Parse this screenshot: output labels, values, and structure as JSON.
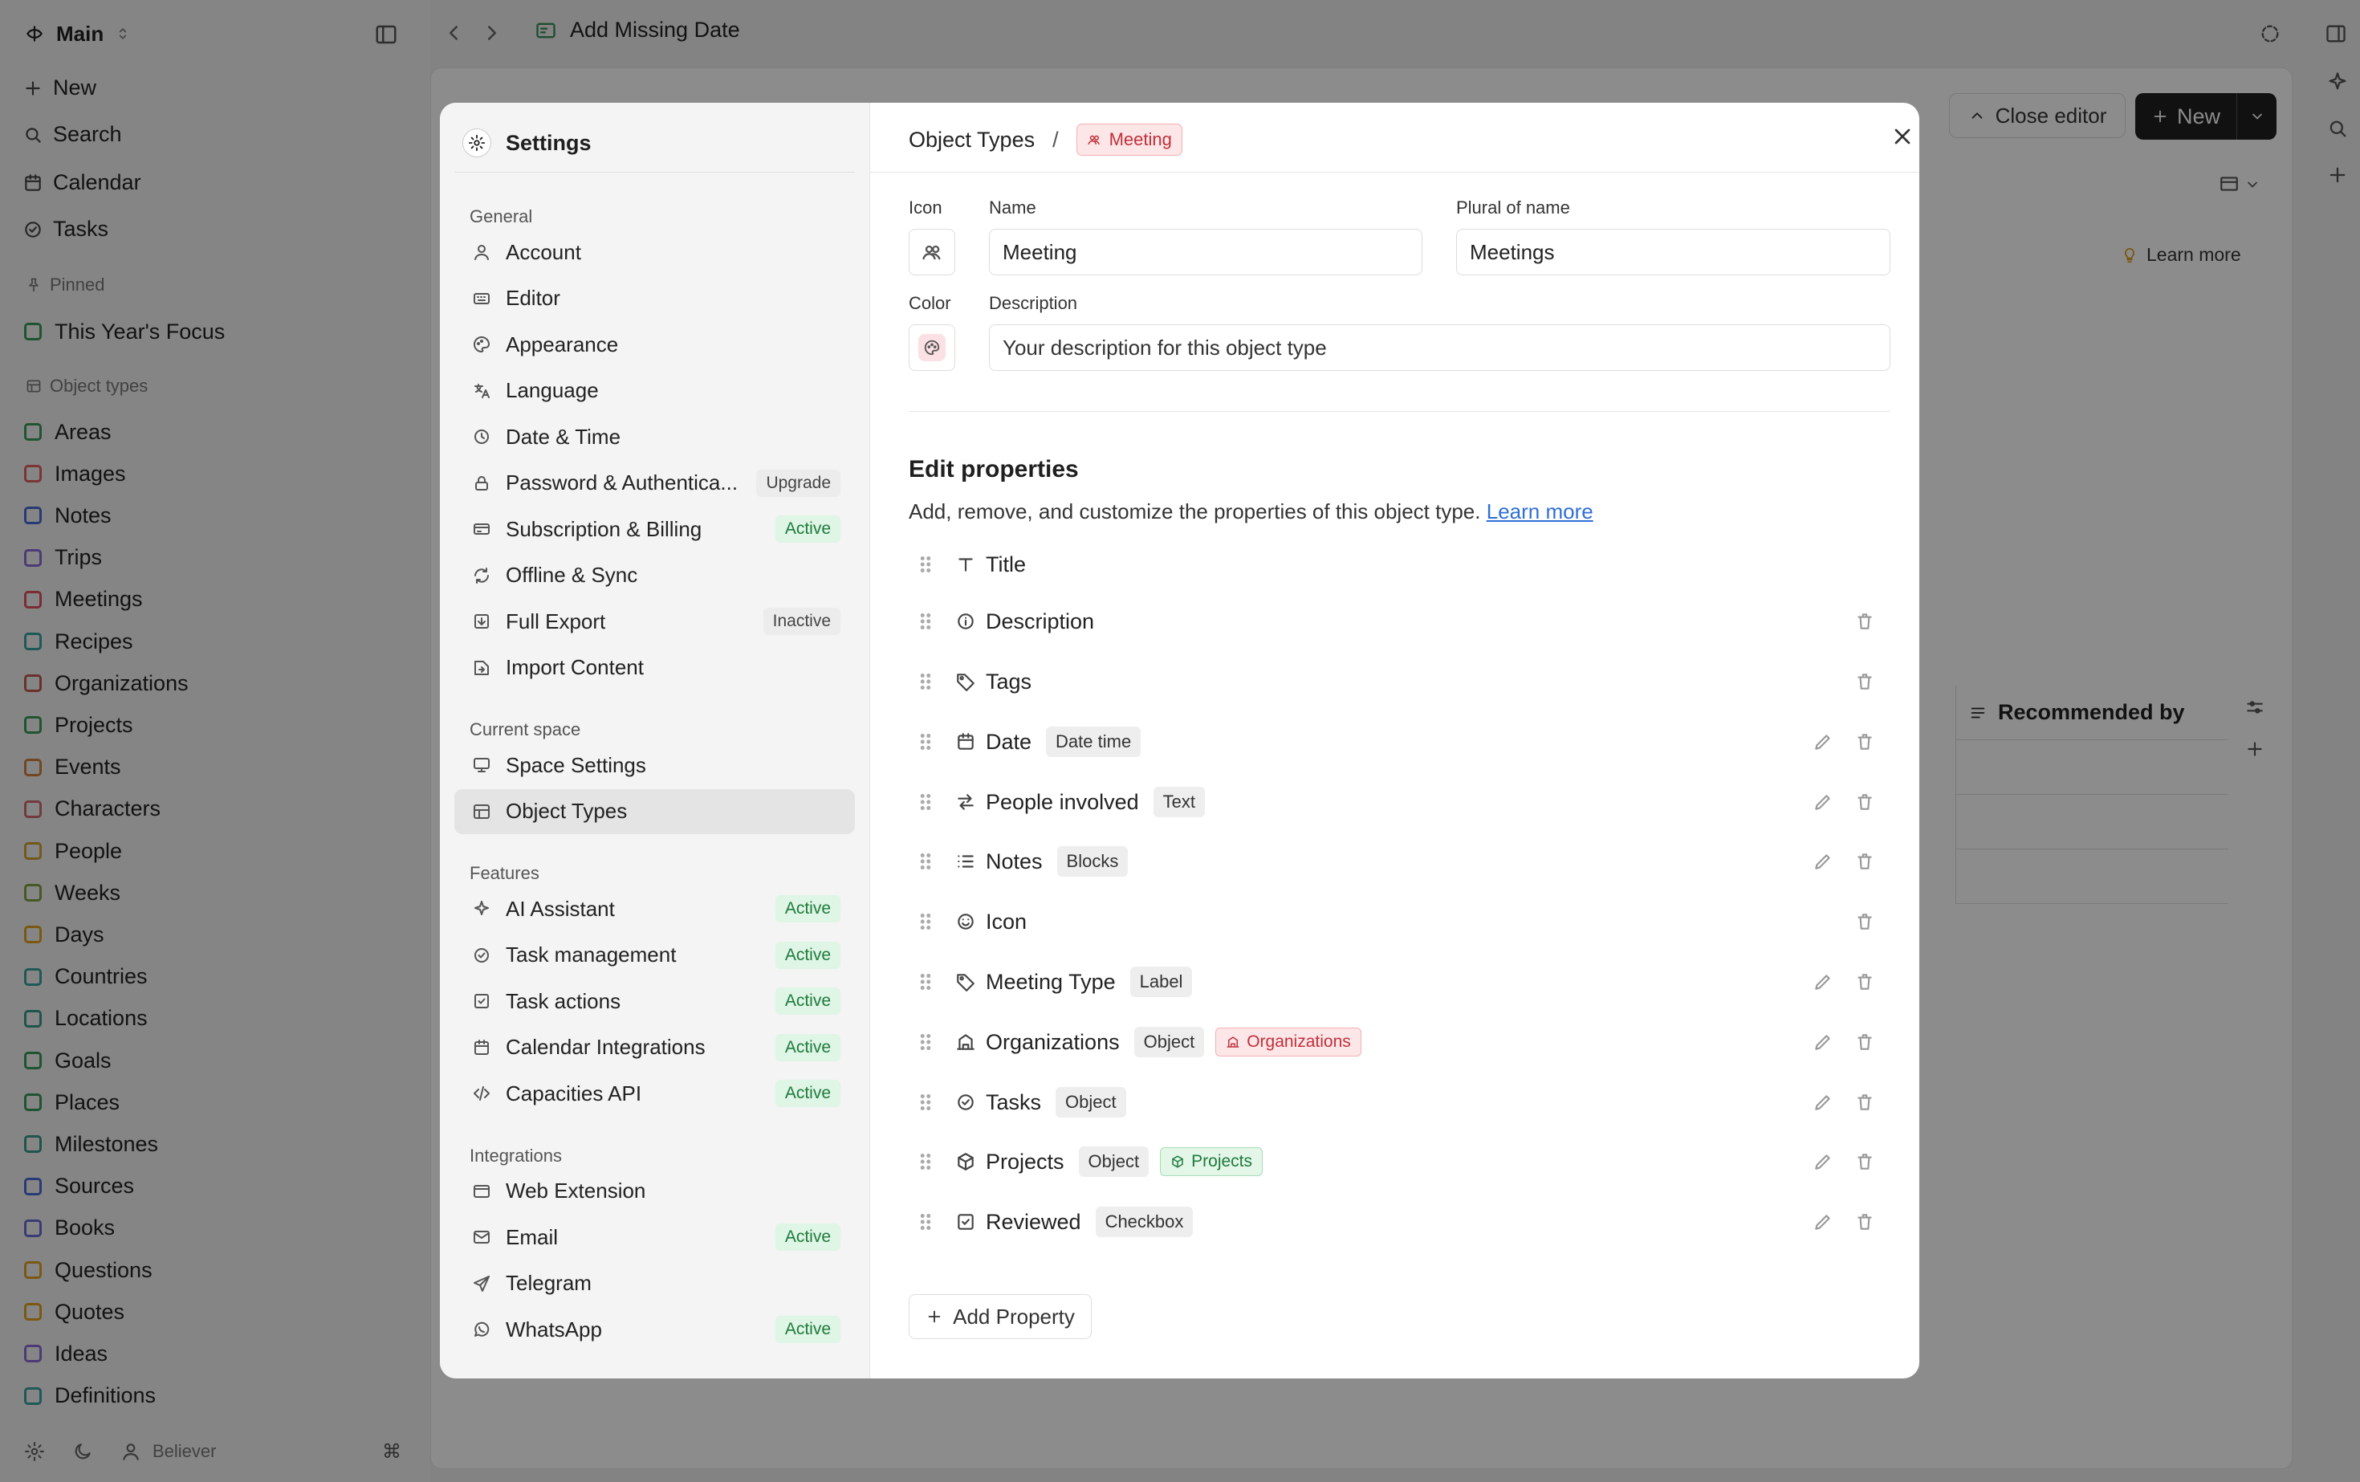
{
  "app": {
    "workspace": "Main",
    "nav": [
      {
        "label": "New",
        "icon": "plus-icon"
      },
      {
        "label": "Search",
        "icon": "search-icon"
      },
      {
        "label": "Calendar",
        "icon": "calendar-icon"
      },
      {
        "label": "Tasks",
        "icon": "check-circle-icon"
      }
    ],
    "pinned_header": "Pinned",
    "pinned": [
      {
        "label": "This Year's Focus",
        "color": "#3a9a5a"
      }
    ],
    "object_types_header": "Object types",
    "object_types": [
      {
        "label": "Areas",
        "color": "#3a9a5a"
      },
      {
        "label": "Images",
        "color": "#e06060"
      },
      {
        "label": "Notes",
        "color": "#4a6ad6"
      },
      {
        "label": "Trips",
        "color": "#8a6ad6"
      },
      {
        "label": "Meetings",
        "color": "#e05060"
      },
      {
        "label": "Recipes",
        "color": "#3aa0a0"
      },
      {
        "label": "Organizations",
        "color": "#c05a50"
      },
      {
        "label": "Projects",
        "color": "#3a9a5a"
      },
      {
        "label": "Events",
        "color": "#d08040"
      },
      {
        "label": "Characters",
        "color": "#d06a70"
      },
      {
        "label": "People",
        "color": "#d0a030"
      },
      {
        "label": "Weeks",
        "color": "#80a040"
      },
      {
        "label": "Days",
        "color": "#e0a020"
      },
      {
        "label": "Countries",
        "color": "#3aa0a0"
      },
      {
        "label": "Locations",
        "color": "#3a9a8a"
      },
      {
        "label": "Goals",
        "color": "#3a9a5a"
      },
      {
        "label": "Places",
        "color": "#3a9a5a"
      },
      {
        "label": "Milestones",
        "color": "#3a9a8a"
      },
      {
        "label": "Sources",
        "color": "#4a6ad6"
      },
      {
        "label": "Books",
        "color": "#6a6ad6"
      },
      {
        "label": "Questions",
        "color": "#e0a020"
      },
      {
        "label": "Quotes",
        "color": "#e0a020"
      },
      {
        "label": "Ideas",
        "color": "#8a6ad6"
      },
      {
        "label": "Definitions",
        "color": "#3aa0a0"
      }
    ],
    "user": "Believer",
    "page_title": "Add Missing Date",
    "close_editor": "Close editor",
    "new_button": "New",
    "learn_more": "Learn more",
    "column_header": "Recommended by"
  },
  "settings": {
    "title": "Settings",
    "groups": [
      {
        "title": "General",
        "items": [
          {
            "label": "Account",
            "icon": "user-icon",
            "badge": ""
          },
          {
            "label": "Editor",
            "icon": "keyboard-icon",
            "badge": ""
          },
          {
            "label": "Appearance",
            "icon": "palette-icon",
            "badge": ""
          },
          {
            "label": "Language",
            "icon": "translate-icon",
            "badge": ""
          },
          {
            "label": "Date & Time",
            "icon": "clock-icon",
            "badge": ""
          },
          {
            "label": "Password & Authentica...",
            "icon": "lock-icon",
            "badge": "Upgrade"
          },
          {
            "label": "Subscription & Billing",
            "icon": "credit-card-icon",
            "badge": "Active"
          },
          {
            "label": "Offline & Sync",
            "icon": "sync-icon",
            "badge": ""
          },
          {
            "label": "Full Export",
            "icon": "export-icon",
            "badge": "Inactive"
          },
          {
            "label": "Import Content",
            "icon": "import-icon",
            "badge": ""
          }
        ]
      },
      {
        "title": "Current space",
        "items": [
          {
            "label": "Space Settings",
            "icon": "monitor-icon",
            "badge": ""
          },
          {
            "label": "Object Types",
            "icon": "table-icon",
            "badge": "",
            "selected": true
          }
        ]
      },
      {
        "title": "Features",
        "items": [
          {
            "label": "AI Assistant",
            "icon": "sparkle-icon",
            "badge": "Active"
          },
          {
            "label": "Task management",
            "icon": "check-circle-icon",
            "badge": "Active"
          },
          {
            "label": "Task actions",
            "icon": "checkbox-icon",
            "badge": "Active"
          },
          {
            "label": "Calendar Integrations",
            "icon": "calendar-icon",
            "badge": "Active"
          },
          {
            "label": "Capacities API",
            "icon": "code-icon",
            "badge": "Active"
          }
        ]
      },
      {
        "title": "Integrations",
        "items": [
          {
            "label": "Web Extension",
            "icon": "browser-icon",
            "badge": ""
          },
          {
            "label": "Email",
            "icon": "mail-icon",
            "badge": "Active"
          },
          {
            "label": "Telegram",
            "icon": "send-icon",
            "badge": ""
          },
          {
            "label": "WhatsApp",
            "icon": "whatsapp-icon",
            "badge": "Active"
          }
        ]
      }
    ]
  },
  "editor": {
    "breadcrumb_root": "Object Types",
    "breadcrumb_chip": "Meeting",
    "icon_label": "Icon",
    "name_label": "Name",
    "name_value": "Meeting",
    "plural_label": "Plural of name",
    "plural_value": "Meetings",
    "color_label": "Color",
    "description_label": "Description",
    "description_placeholder": "Your description for this object type",
    "section_title": "Edit properties",
    "section_sub": "Add, remove, and customize the properties of this object type.",
    "section_link": "Learn more",
    "add_property": "Add Property",
    "properties": [
      {
        "name": "Title",
        "icon": "text-icon",
        "type": "",
        "tag": "",
        "editable": false,
        "deletable": false
      },
      {
        "name": "Description",
        "icon": "info-icon",
        "type": "",
        "tag": "",
        "editable": false,
        "deletable": true
      },
      {
        "name": "Tags",
        "icon": "tag-icon",
        "type": "",
        "tag": "",
        "editable": false,
        "deletable": true
      },
      {
        "name": "Date",
        "icon": "calendar-icon",
        "type": "Date time",
        "tag": "",
        "editable": true,
        "deletable": true
      },
      {
        "name": "People involved",
        "icon": "arrows-icon",
        "type": "Text",
        "tag": "",
        "editable": true,
        "deletable": true
      },
      {
        "name": "Notes",
        "icon": "list-icon",
        "type": "Blocks",
        "tag": "",
        "editable": true,
        "deletable": true
      },
      {
        "name": "Icon",
        "icon": "smile-icon",
        "type": "",
        "tag": "",
        "editable": false,
        "deletable": true
      },
      {
        "name": "Meeting Type",
        "icon": "tag-icon",
        "type": "Label",
        "tag": "",
        "editable": true,
        "deletable": true
      },
      {
        "name": "Organizations",
        "icon": "building-icon",
        "type": "Object",
        "tag": "Organizations",
        "tag_color": "#c0303b",
        "tag_bg": "#fde6e7",
        "tag_border": "#f3b0b4",
        "editable": true,
        "deletable": true
      },
      {
        "name": "Tasks",
        "icon": "check-circle-icon",
        "type": "Object",
        "tag": "",
        "editable": true,
        "deletable": true
      },
      {
        "name": "Projects",
        "icon": "box-icon",
        "type": "Object",
        "tag": "Projects",
        "tag_color": "#1d7a3c",
        "tag_bg": "#e3f6e8",
        "tag_border": "#a9dcb8",
        "editable": true,
        "deletable": true
      },
      {
        "name": "Reviewed",
        "icon": "checkbox-icon",
        "type": "Checkbox",
        "tag": "",
        "editable": true,
        "deletable": true
      }
    ]
  }
}
